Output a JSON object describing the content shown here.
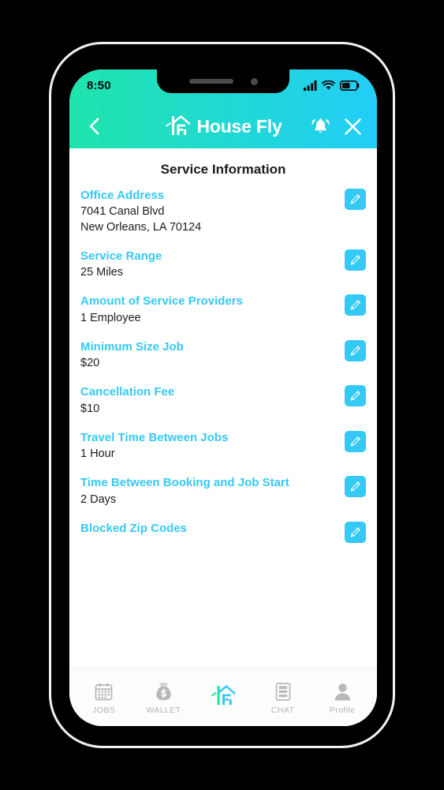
{
  "status_bar": {
    "time": "8:50",
    "icons": [
      "signal-icon",
      "wifi-icon",
      "battery-icon"
    ]
  },
  "header": {
    "back_icon": "chevron-left-icon",
    "logo_icon": "house-fly-logo-icon",
    "brand": "House Fly",
    "bell_icon": "notification-bell-icon",
    "close_icon": "close-icon"
  },
  "main": {
    "title": "Service Information",
    "edit_icon": "pencil-icon",
    "rows": [
      {
        "label": "Office Address",
        "value": "7041 Canal Blvd\nNew Orleans, LA 70124",
        "edit": true
      },
      {
        "label": "Service Range",
        "value": "25 Miles",
        "edit": true
      },
      {
        "label": "Amount of Service Providers",
        "value": "1 Employee",
        "edit": true
      },
      {
        "label": "Minimum Size Job",
        "value": "$20",
        "edit": true
      },
      {
        "label": "Cancellation Fee",
        "value": "$10",
        "edit": true
      },
      {
        "label": "Travel Time Between Jobs",
        "value": "1 Hour",
        "edit": true
      },
      {
        "label": "Time Between Booking and Job Start",
        "value": "2 Days",
        "edit": true
      },
      {
        "label": "Blocked Zip Codes",
        "value": "",
        "edit": true
      }
    ]
  },
  "tabbar": {
    "items": [
      {
        "label": "JOBS",
        "icon": "calendar-icon",
        "active": false
      },
      {
        "label": "WALLET",
        "icon": "money-bag-icon",
        "active": false
      },
      {
        "label": "",
        "icon": "house-fly-logo-icon",
        "active": true
      },
      {
        "label": "CHAT",
        "icon": "chat-list-icon",
        "active": false
      },
      {
        "label": "Profile",
        "icon": "person-icon",
        "active": false
      }
    ]
  },
  "colors": {
    "gradient_start": "#1fe5ac",
    "gradient_end": "#22cdf7",
    "accent": "#35c9f5",
    "logo_green": "#20e59f",
    "tab_inactive": "#b4b4b4"
  }
}
